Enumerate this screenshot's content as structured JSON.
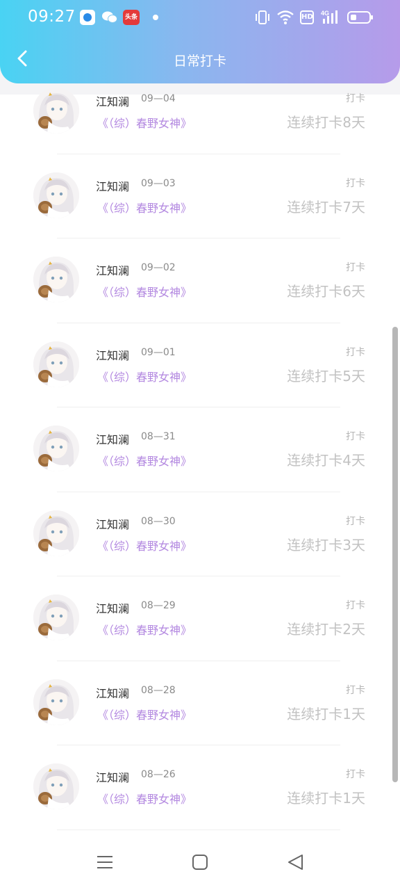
{
  "status_bar": {
    "time": "09:27",
    "app_icons": [
      "circle-app-icon",
      "wechat-icon",
      "toutiao-icon"
    ],
    "toutiao_label": "头条",
    "hd_label": "HD",
    "network": "4G"
  },
  "header": {
    "title": "日常打卡",
    "back_icon": "chevron-left-icon",
    "gradient": [
      "#49d3f3",
      "#b69bea"
    ]
  },
  "checkins": [
    {
      "user": "江知澜",
      "date": "09—04",
      "book": "《（综）春野女神》",
      "action": "打卡",
      "streak": "连续打卡8天"
    },
    {
      "user": "江知澜",
      "date": "09—03",
      "book": "《（综）春野女神》",
      "action": "打卡",
      "streak": "连续打卡7天"
    },
    {
      "user": "江知澜",
      "date": "09—02",
      "book": "《（综）春野女神》",
      "action": "打卡",
      "streak": "连续打卡6天"
    },
    {
      "user": "江知澜",
      "date": "09—01",
      "book": "《（综）春野女神》",
      "action": "打卡",
      "streak": "连续打卡5天"
    },
    {
      "user": "江知澜",
      "date": "08—31",
      "book": "《（综）春野女神》",
      "action": "打卡",
      "streak": "连续打卡4天"
    },
    {
      "user": "江知澜",
      "date": "08—30",
      "book": "《（综）春野女神》",
      "action": "打卡",
      "streak": "连续打卡3天"
    },
    {
      "user": "江知澜",
      "date": "08—29",
      "book": "《（综）春野女神》",
      "action": "打卡",
      "streak": "连续打卡2天"
    },
    {
      "user": "江知澜",
      "date": "08—28",
      "book": "《（综）春野女神》",
      "action": "打卡",
      "streak": "连续打卡1天"
    },
    {
      "user": "江知澜",
      "date": "08—26",
      "book": "《（综）春野女神》",
      "action": "打卡",
      "streak": "连续打卡1天"
    }
  ],
  "colors": {
    "book_title": "#b388e0",
    "streak_text": "#c2c2c2",
    "action_text": "#b5b5b5"
  },
  "system_nav": [
    "menu-icon",
    "home-icon",
    "back-triangle-icon"
  ]
}
